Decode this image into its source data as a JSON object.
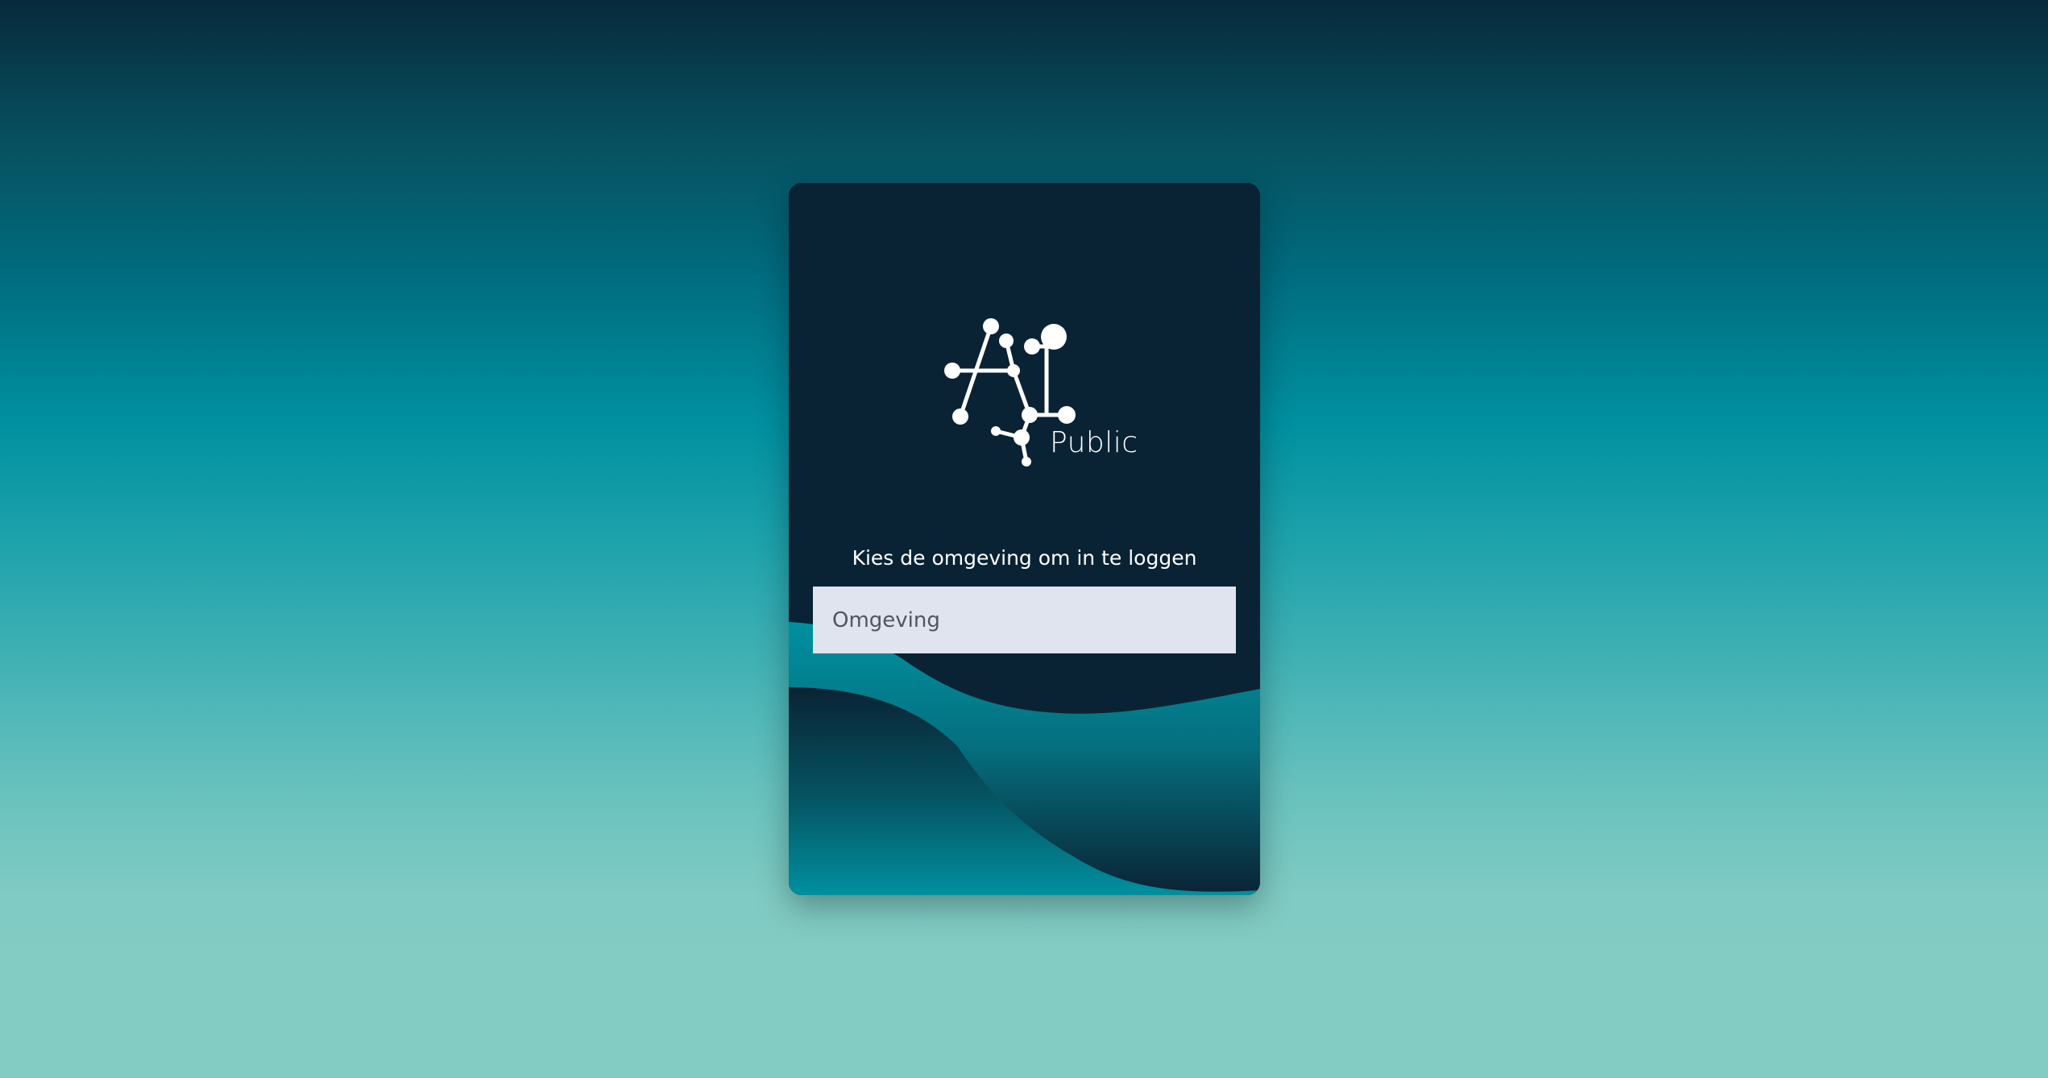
{
  "logo": {
    "mark": "AI",
    "wordmark": "Public"
  },
  "login": {
    "prompt": "Kies de omgeving om in te loggen",
    "environment_select": {
      "placeholder": "Omgeving",
      "value": ""
    }
  },
  "colors": {
    "card_background": "#0a2334",
    "accent_teal": "#0090a0",
    "input_background": "#e0e4ee",
    "text_light": "#ffffff"
  }
}
